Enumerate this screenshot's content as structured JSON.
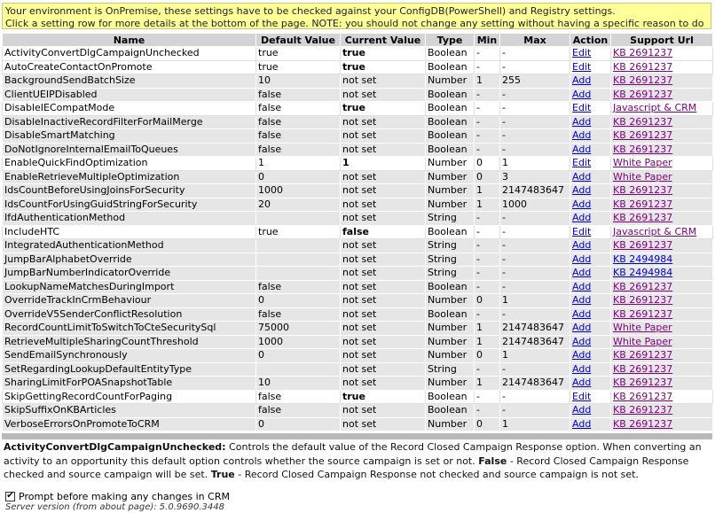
{
  "banner": {
    "line1": "Your environment is OnPremise, these settings have to be checked against your ConfigDB(PowerShell) and Registry settings.",
    "line2": "Click a setting row for more details at the bottom of the page. NOTE: you should not change any setting without having a specific reason to do so."
  },
  "table": {
    "headers": [
      "Name",
      "Default Value",
      "Current Value",
      "Type",
      "Min",
      "Max",
      "Action",
      "Support Url"
    ],
    "rows": [
      {
        "name": "ActivityConvertDlgCampaignUnchecked",
        "default": "true",
        "current": "true",
        "type": "Boolean",
        "min": "-",
        "max": "-",
        "action": "Edit",
        "url": "KB 2691237",
        "modified": true
      },
      {
        "name": "AutoCreateContactOnPromote",
        "default": "true",
        "current": "true",
        "type": "Boolean",
        "min": "-",
        "max": "-",
        "action": "Edit",
        "url": "KB 2691237",
        "modified": true
      },
      {
        "name": "BackgroundSendBatchSize",
        "default": "10",
        "current": "not set",
        "type": "Number",
        "min": "1",
        "max": "255",
        "action": "Add",
        "url": "KB 2691237",
        "modified": false
      },
      {
        "name": "ClientUEIPDisabled",
        "default": "false",
        "current": "not set",
        "type": "Boolean",
        "min": "-",
        "max": "-",
        "action": "Add",
        "url": "KB 2691237",
        "modified": false
      },
      {
        "name": "DisableIECompatMode",
        "default": "false",
        "current": "true",
        "type": "Boolean",
        "min": "-",
        "max": "-",
        "action": "Edit",
        "url": "Javascript & CRM",
        "modified": true
      },
      {
        "name": "DisableInactiveRecordFilterForMailMerge",
        "default": "false",
        "current": "not set",
        "type": "Boolean",
        "min": "-",
        "max": "-",
        "action": "Add",
        "url": "KB 2691237",
        "modified": false
      },
      {
        "name": "DisableSmartMatching",
        "default": "false",
        "current": "not set",
        "type": "Boolean",
        "min": "-",
        "max": "-",
        "action": "Add",
        "url": "KB 2691237",
        "modified": false
      },
      {
        "name": "DoNotIgnoreInternalEmailToQueues",
        "default": "false",
        "current": "not set",
        "type": "Boolean",
        "min": "-",
        "max": "-",
        "action": "Add",
        "url": "KB 2691237",
        "modified": false
      },
      {
        "name": "EnableQuickFindOptimization",
        "default": "1",
        "current": "1",
        "type": "Number",
        "min": "0",
        "max": "1",
        "action": "Edit",
        "url": "White Paper",
        "modified": true
      },
      {
        "name": "EnableRetrieveMultipleOptimization",
        "default": "0",
        "current": "not set",
        "type": "Number",
        "min": "0",
        "max": "3",
        "action": "Add",
        "url": "White Paper",
        "modified": false
      },
      {
        "name": "IdsCountBeforeUsingJoinsForSecurity",
        "default": "1000",
        "current": "not set",
        "type": "Number",
        "min": "1",
        "max": "2147483647",
        "action": "Add",
        "url": "KB 2691237",
        "modified": false
      },
      {
        "name": "IdsCountForUsingGuidStringForSecurity",
        "default": "20",
        "current": "not set",
        "type": "Number",
        "min": "1",
        "max": "1000",
        "action": "Add",
        "url": "KB 2691237",
        "modified": false
      },
      {
        "name": "IfdAuthenticationMethod",
        "default": "",
        "current": "not set",
        "type": "String",
        "min": "-",
        "max": "-",
        "action": "Add",
        "url": "KB 2691237",
        "modified": false
      },
      {
        "name": "IncludeHTC",
        "default": "true",
        "current": "false",
        "type": "Boolean",
        "min": "-",
        "max": "-",
        "action": "Edit",
        "url": "Javascript & CRM",
        "modified": true
      },
      {
        "name": "IntegratedAuthenticationMethod",
        "default": "",
        "current": "not set",
        "type": "String",
        "min": "-",
        "max": "-",
        "action": "Add",
        "url": "KB 2691237",
        "modified": false
      },
      {
        "name": "JumpBarAlphabetOverride",
        "default": "",
        "current": "not set",
        "type": "String",
        "min": "-",
        "max": "-",
        "action": "Add",
        "url": "KB 2494984",
        "modified": false
      },
      {
        "name": "JumpBarNumberIndicatorOverride",
        "default": "",
        "current": "not set",
        "type": "String",
        "min": "-",
        "max": "-",
        "action": "Add",
        "url": "KB 2494984",
        "modified": false
      },
      {
        "name": "LookupNameMatchesDuringImport",
        "default": "false",
        "current": "not set",
        "type": "Boolean",
        "min": "-",
        "max": "-",
        "action": "Add",
        "url": "KB 2691237",
        "modified": false
      },
      {
        "name": "OverrideTrackInCrmBehaviour",
        "default": "0",
        "current": "not set",
        "type": "Number",
        "min": "0",
        "max": "1",
        "action": "Add",
        "url": "KB 2691237",
        "modified": false
      },
      {
        "name": "OverrideV5SenderConflictResolution",
        "default": "false",
        "current": "not set",
        "type": "Boolean",
        "min": "-",
        "max": "-",
        "action": "Add",
        "url": "KB 2691237",
        "modified": false
      },
      {
        "name": "RecordCountLimitToSwitchToCteSecuritySql",
        "default": "75000",
        "current": "not set",
        "type": "Number",
        "min": "1",
        "max": "2147483647",
        "action": "Add",
        "url": "White Paper",
        "modified": false
      },
      {
        "name": "RetrieveMultipleSharingCountThreshold",
        "default": "1000",
        "current": "not set",
        "type": "Number",
        "min": "1",
        "max": "2147483647",
        "action": "Add",
        "url": "White Paper",
        "modified": false
      },
      {
        "name": "SendEmailSynchronously",
        "default": "0",
        "current": "not set",
        "type": "Number",
        "min": "0",
        "max": "1",
        "action": "Add",
        "url": "KB 2691237",
        "modified": false
      },
      {
        "name": "SetRegardingLookupDefaultEntityType",
        "default": "",
        "current": "not set",
        "type": "String",
        "min": "-",
        "max": "-",
        "action": "Add",
        "url": "KB 2691237",
        "modified": false
      },
      {
        "name": "SharingLimitForPOASnapshotTable",
        "default": "10",
        "current": "not set",
        "type": "Number",
        "min": "1",
        "max": "2147483647",
        "action": "Add",
        "url": "KB 2691237",
        "modified": false
      },
      {
        "name": "SkipGettingRecordCountForPaging",
        "default": "false",
        "current": "true",
        "type": "Boolean",
        "min": "-",
        "max": "-",
        "action": "Edit",
        "url": "KB 2691237",
        "modified": true
      },
      {
        "name": "SkipSuffixOnKBArticles",
        "default": "false",
        "current": "not set",
        "type": "Boolean",
        "min": "-",
        "max": "-",
        "action": "Add",
        "url": "KB 2691237",
        "modified": false
      },
      {
        "name": "VerboseErrorsOnPromoteToCRM",
        "default": "0",
        "current": "not set",
        "type": "Number",
        "min": "0",
        "max": "1",
        "action": "Add",
        "url": "KB 2691237",
        "modified": false
      }
    ]
  },
  "details": {
    "setting_name": "ActivityConvertDlgCampaignUnchecked:",
    "text1": " Controls the default value of the Record Closed Campaign Response option. When converting an activity to an opportunity this default option controls whether the source campaign is set or not. ",
    "false_label": "False",
    "text2": " - Record Closed Campaign Response checked and source campaign will be set. ",
    "true_label": "True",
    "text3": " - Record Closed Campaign Response not checked and source campaign is not set."
  },
  "prompt": {
    "label": "Prompt before making any changes in CRM",
    "checked": true
  },
  "version": "Server version (from about page): 5.0.9690.3448"
}
